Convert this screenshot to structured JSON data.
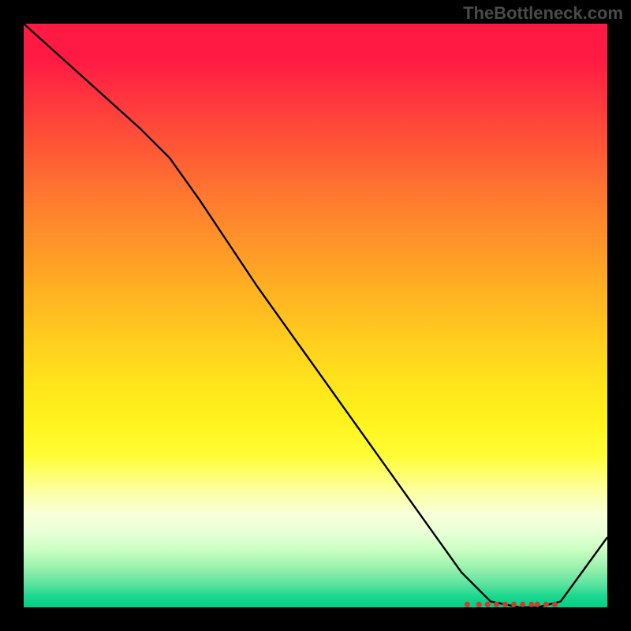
{
  "watermark": "TheBottleneck.com",
  "chart_data": {
    "type": "line",
    "title": "",
    "xlabel": "",
    "ylabel": "",
    "xlim": [
      0,
      100
    ],
    "ylim": [
      0,
      100
    ],
    "grid": false,
    "legend": false,
    "background_gradient_stops": [
      {
        "pos": 0,
        "color": "#ff1a44"
      },
      {
        "pos": 6,
        "color": "#ff1a44"
      },
      {
        "pos": 14,
        "color": "#ff3a3d"
      },
      {
        "pos": 22,
        "color": "#ff5a35"
      },
      {
        "pos": 30,
        "color": "#ff7a2f"
      },
      {
        "pos": 38,
        "color": "#ff9628"
      },
      {
        "pos": 46,
        "color": "#ffb222"
      },
      {
        "pos": 54,
        "color": "#ffcd1e"
      },
      {
        "pos": 62,
        "color": "#ffe51c"
      },
      {
        "pos": 68,
        "color": "#fff31c"
      },
      {
        "pos": 74,
        "color": "#fffd36"
      },
      {
        "pos": 80,
        "color": "#fdffa0"
      },
      {
        "pos": 84,
        "color": "#f8ffd8"
      },
      {
        "pos": 87,
        "color": "#eaffd8"
      },
      {
        "pos": 90,
        "color": "#ccffc4"
      },
      {
        "pos": 93,
        "color": "#9df2ae"
      },
      {
        "pos": 96,
        "color": "#5ce3a0"
      },
      {
        "pos": 98,
        "color": "#1ed890"
      },
      {
        "pos": 100,
        "color": "#00d084"
      }
    ],
    "series": [
      {
        "name": "bottleneck-curve",
        "x": [
          0,
          10,
          20,
          25,
          30,
          40,
          50,
          60,
          70,
          75,
          80,
          85,
          88,
          92,
          100
        ],
        "y": [
          100,
          91,
          82,
          77,
          70,
          55,
          41,
          27,
          13,
          6,
          1,
          0,
          0,
          1,
          12
        ]
      }
    ],
    "markers": {
      "name": "min-region",
      "y": 0.5,
      "x": [
        76,
        78,
        79.5,
        81,
        82.5,
        84,
        85.5,
        87,
        88,
        89.5,
        91
      ]
    }
  }
}
